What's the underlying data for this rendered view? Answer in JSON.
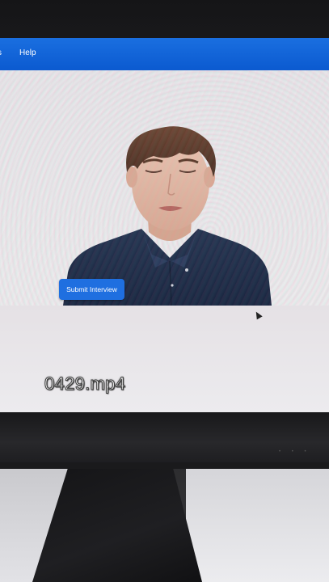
{
  "app": {
    "menu_partial": "s",
    "menu_help": "Help"
  },
  "content": {
    "submit_label": "Submit Interview"
  },
  "overlay": {
    "filename": "0429.mp4"
  },
  "colors": {
    "app_bar": "#0b5ad0",
    "button": "#1f6fe0",
    "shirt": "#1f2d48",
    "hair": "#5a3828"
  }
}
